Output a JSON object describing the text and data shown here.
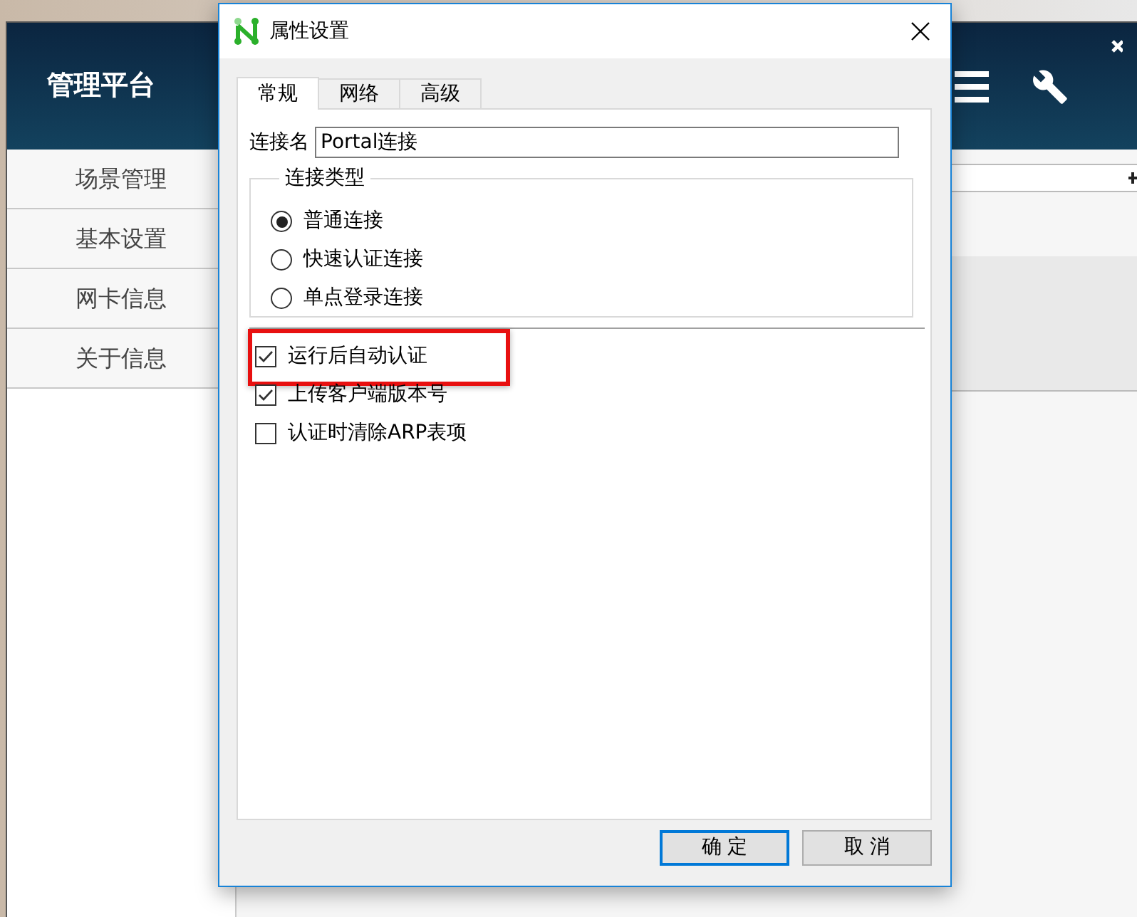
{
  "app": {
    "title": "管理平台",
    "nav": [
      {
        "label": "场景管理"
      },
      {
        "label": "基本设置"
      },
      {
        "label": "网卡信息"
      },
      {
        "label": "关于信息"
      }
    ]
  },
  "dialog": {
    "title": "属性设置",
    "tabs": [
      {
        "label": "常规",
        "selected": true
      },
      {
        "label": "网络",
        "selected": false
      },
      {
        "label": "高级",
        "selected": false
      }
    ],
    "connection_name": {
      "label": "连接名",
      "value": "Portal连接"
    },
    "connection_type": {
      "legend": "连接类型",
      "options": [
        {
          "label": "普通连接",
          "selected": true
        },
        {
          "label": "快速认证连接",
          "selected": false
        },
        {
          "label": "单点登录连接",
          "selected": false
        }
      ]
    },
    "checkboxes": [
      {
        "label": "运行后自动认证",
        "checked": true,
        "highlighted": true
      },
      {
        "label": "上传客户端版本号",
        "checked": true,
        "highlighted": false
      },
      {
        "label": "认证时清除ARP表项",
        "checked": false,
        "highlighted": false
      }
    ],
    "buttons": [
      {
        "label": "确 定",
        "default": true
      },
      {
        "label": "取 消",
        "default": false
      }
    ]
  }
}
